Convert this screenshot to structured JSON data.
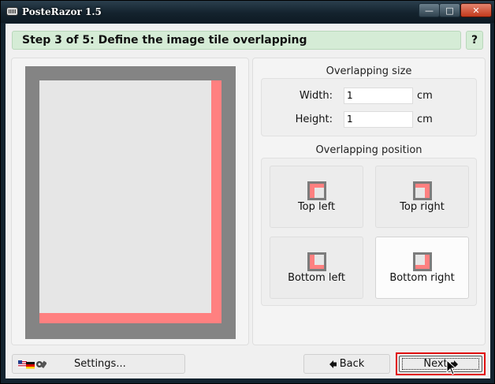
{
  "window": {
    "title": "PosteRazor 1.5",
    "min_glyph": "—",
    "max_glyph": "□",
    "close_glyph": "✕"
  },
  "header": {
    "step_title": "Step 3 of 5: Define the image tile overlapping",
    "help_label": "?"
  },
  "overlapping_size": {
    "title": "Overlapping size",
    "width_label": "Width:",
    "width_value": "1",
    "height_label": "Height:",
    "height_value": "1",
    "unit": "cm"
  },
  "overlapping_position": {
    "title": "Overlapping position",
    "options": [
      {
        "label": "Top left",
        "selected": false
      },
      {
        "label": "Top right",
        "selected": false
      },
      {
        "label": "Bottom left",
        "selected": false
      },
      {
        "label": "Bottom right",
        "selected": true
      }
    ]
  },
  "footer": {
    "settings_label": "Settings...",
    "back_label": "Back",
    "next_label": "Next"
  },
  "colors": {
    "overlap": "#ff8080",
    "page": "#e6e6e6",
    "frame": "#848484",
    "highlight": "#e00000"
  }
}
